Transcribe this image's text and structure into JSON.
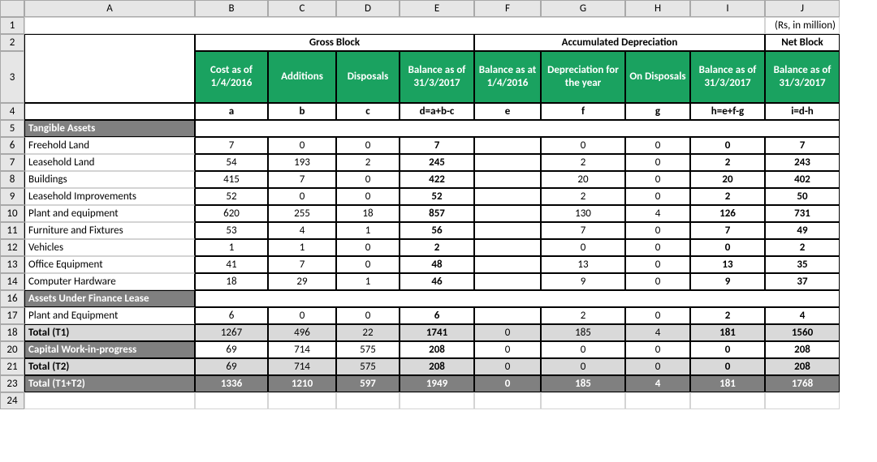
{
  "columns": [
    "",
    "A",
    "B",
    "C",
    "D",
    "E",
    "F",
    "G",
    "H",
    "I",
    "J"
  ],
  "row_numbers": [
    "1",
    "2",
    "3",
    "4",
    "5",
    "6",
    "7",
    "8",
    "9",
    "10",
    "11",
    "12",
    "13",
    "14",
    "16",
    "17",
    "18",
    "20",
    "21",
    "23",
    "24"
  ],
  "unit_label": "(Rs, in million)",
  "group_headers": {
    "gross": "Gross Block",
    "accdep": "Accumulated Depreciation",
    "net": "Net Block"
  },
  "headers": {
    "b": "Cost as of 1/4/2016",
    "c": "Additions",
    "d": "Disposals",
    "e": "Balance as of 31/3/2017",
    "f": "Balance as at 1/4/2016",
    "g": "Depreciation for the year",
    "h": "On Disposals",
    "i": "Balance as of 31/3/2017",
    "j": "Balance as of 31/3/2017"
  },
  "formula_row": {
    "b": "a",
    "c": "b",
    "d": "c",
    "e": "d=a+b-c",
    "f": "e",
    "g": "f",
    "h": "g",
    "i": "h=e+f-g",
    "j": "i=d-h"
  },
  "sections": {
    "tangible": "Tangible Assets",
    "lease": "Assets Under Finance Lease",
    "cwip": "Capital Work-in-progress"
  },
  "rows": [
    {
      "a": "Freehold Land",
      "b": "7",
      "c": "0",
      "d": "0",
      "e": "7",
      "f": "",
      "g": "0",
      "h": "0",
      "i": "0",
      "j": "7"
    },
    {
      "a": "Leasehold Land",
      "b": "54",
      "c": "193",
      "d": "2",
      "e": "245",
      "f": "",
      "g": "2",
      "h": "0",
      "i": "2",
      "j": "243"
    },
    {
      "a": "Buildings",
      "b": "415",
      "c": "7",
      "d": "0",
      "e": "422",
      "f": "",
      "g": "20",
      "h": "0",
      "i": "20",
      "j": "402"
    },
    {
      "a": "Leasehold Improvements",
      "b": "52",
      "c": "0",
      "d": "0",
      "e": "52",
      "f": "",
      "g": "2",
      "h": "0",
      "i": "2",
      "j": "50"
    },
    {
      "a": "Plant and equipment",
      "b": "620",
      "c": "255",
      "d": "18",
      "e": "857",
      "f": "",
      "g": "130",
      "h": "4",
      "i": "126",
      "j": "731"
    },
    {
      "a": "Furniture and Fixtures",
      "b": "53",
      "c": "4",
      "d": "1",
      "e": "56",
      "f": "",
      "g": "7",
      "h": "0",
      "i": "7",
      "j": "49"
    },
    {
      "a": "Vehicles",
      "b": "1",
      "c": "1",
      "d": "0",
      "e": "2",
      "f": "",
      "g": "0",
      "h": "0",
      "i": "0",
      "j": "2"
    },
    {
      "a": "Office Equipment",
      "b": "41",
      "c": "7",
      "d": "0",
      "e": "48",
      "f": "",
      "g": "13",
      "h": "0",
      "i": "13",
      "j": "35"
    },
    {
      "a": "Computer Hardware",
      "b": "18",
      "c": "29",
      "d": "1",
      "e": "46",
      "f": "",
      "g": "9",
      "h": "0",
      "i": "9",
      "j": "37"
    }
  ],
  "lease_row": {
    "a": "Plant and Equipment",
    "b": "6",
    "c": "0",
    "d": "0",
    "e": "6",
    "f": "",
    "g": "2",
    "h": "0",
    "i": "2",
    "j": "4"
  },
  "totals": {
    "t1": {
      "a": "Total (T1)",
      "b": "1267",
      "c": "496",
      "d": "22",
      "e": "1741",
      "f": "0",
      "g": "185",
      "h": "4",
      "i": "181",
      "j": "1560"
    },
    "cwip": {
      "a": "Capital Work-in-progress",
      "b": "69",
      "c": "714",
      "d": "575",
      "e": "208",
      "f": "0",
      "g": "0",
      "h": "0",
      "i": "0",
      "j": "208"
    },
    "t2": {
      "a": "Total (T2)",
      "b": "69",
      "c": "714",
      "d": "575",
      "e": "208",
      "f": "0",
      "g": "0",
      "h": "0",
      "i": "0",
      "j": "208"
    },
    "grand": {
      "a": "Total (T1+T2)",
      "b": "1336",
      "c": "1210",
      "d": "597",
      "e": "1949",
      "f": "0",
      "g": "185",
      "h": "4",
      "i": "181",
      "j": "1768"
    }
  }
}
